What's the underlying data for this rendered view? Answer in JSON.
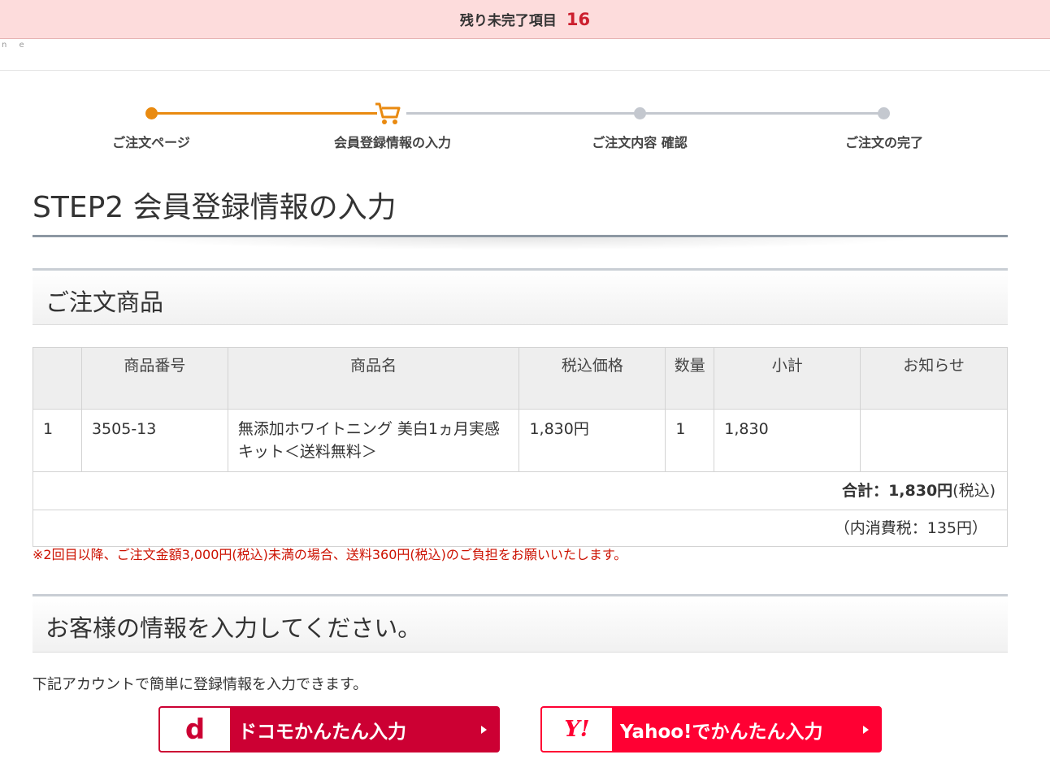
{
  "top_bar": {
    "label": "残り未完了項目",
    "count": "16"
  },
  "header": {
    "logo_fragment": "n e"
  },
  "steps": [
    {
      "label": "ご注文ページ",
      "state": "done"
    },
    {
      "label": "会員登録情報の入力",
      "state": "current"
    },
    {
      "label": "ご注文内容 確認",
      "state": "todo"
    },
    {
      "label": "ご注文の完了",
      "state": "todo"
    }
  ],
  "page_title": "STEP2 会員登録情報の入力",
  "order_section": {
    "heading": "ご注文商品",
    "columns": [
      "",
      "商品番号",
      "商品名",
      "税込価格",
      "数量",
      "小計",
      "お知らせ"
    ],
    "rows": [
      {
        "no": "1",
        "code": "3505-13",
        "name": "無添加ホワイトニング 美白1ヵ月実感キット＜送料無料＞",
        "price": "1,830円",
        "qty": "1",
        "subtotal": "1,830",
        "notice": ""
      }
    ],
    "total_label": "合計：",
    "total_value": "1,830円",
    "total_suffix": "(税込)",
    "tax_note": "（内消費税：135円）"
  },
  "notice": "※2回目以降、ご注文金額3,000円(税込)未満の場合、送料360円(税込)のご負担をお願いいたします。",
  "customer_section": {
    "heading": "お客様の情報を入力してください。",
    "account_text": "下記アカウントで簡単に登録情報を入力できます。"
  },
  "buttons": {
    "docomo": {
      "logo": "d",
      "label": "ドコモかんたん入力"
    },
    "yahoo": {
      "logo": "Y!",
      "label": "Yahoo!でかんたん入力"
    }
  },
  "colors": {
    "accent_orange": "#e98a10",
    "alert_red": "#cc1f2e",
    "docomo_red": "#cc0033",
    "yahoo_red": "#ff0033"
  },
  "icons": {
    "current_step": "cart-icon",
    "button_arrow": "triangle-right-icon"
  }
}
